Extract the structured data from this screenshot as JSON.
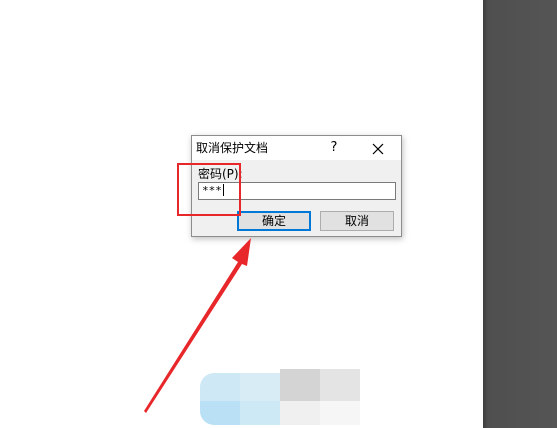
{
  "dialog": {
    "title": "取消保护文档",
    "help_label": "?",
    "password_label": "密码(P):",
    "password_value": "***",
    "ok_label": "确定",
    "cancel_label": "取消"
  },
  "icons": {
    "close": "close-icon",
    "arrow": "red-arrow-annotation"
  },
  "colors": {
    "annotation_red": "#e8272b",
    "focus_blue": "#0078d7",
    "app_frame_gray": "#555555"
  }
}
